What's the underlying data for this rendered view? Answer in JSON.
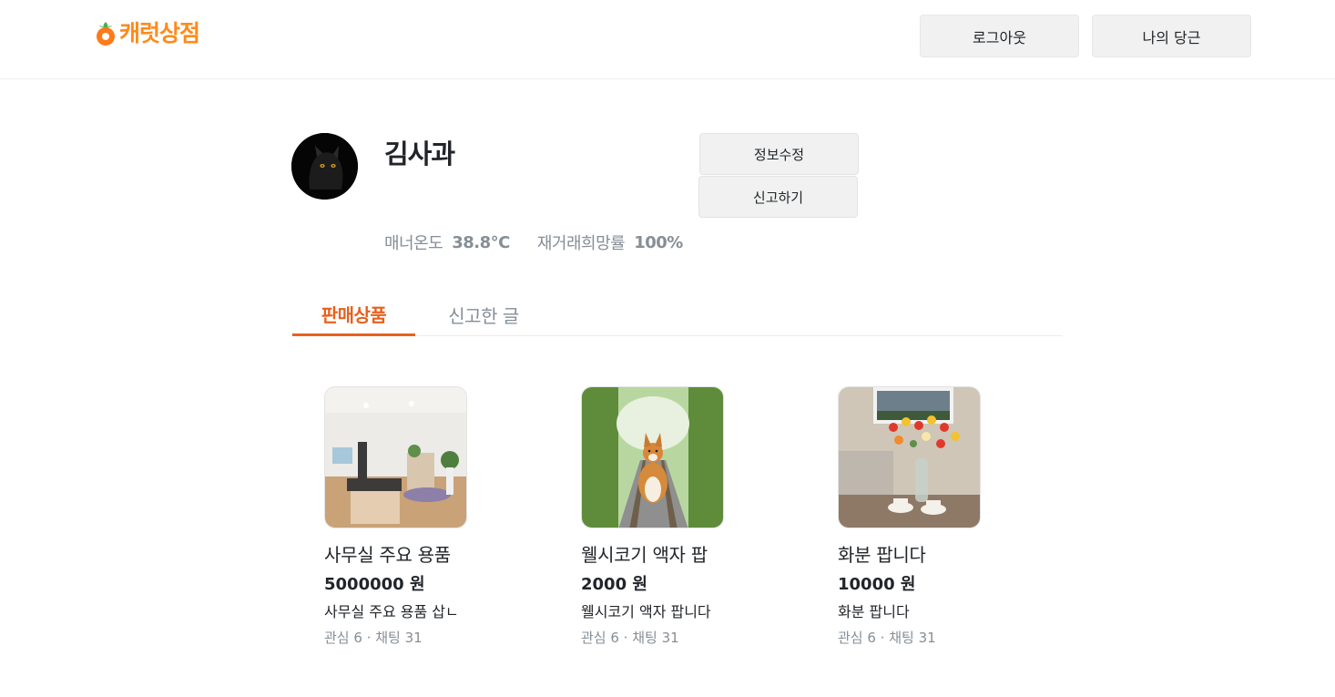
{
  "header": {
    "logo_text": "캐럿상점",
    "logout_label": "로그아웃",
    "my_carrot_label": "나의 당근"
  },
  "profile": {
    "name": "김사과",
    "edit_label": "정보수정",
    "report_label": "신고하기",
    "manner_label": "매너온도",
    "manner_value": "38.8°C",
    "rebuy_label": "재거래희망률",
    "rebuy_value": "100%"
  },
  "tabs": {
    "selling": "판매상품",
    "reported": "신고한 글"
  },
  "products": [
    {
      "title": "사무실 주요 용품",
      "price": "5000000 원",
      "desc": "사무실 주요 용품 삽ㄴ",
      "meta": "관심 6 · 채팅 31"
    },
    {
      "title": "웰시코기 액자 팝",
      "price": "2000 원",
      "desc": "웰시코기 액자 팝니다",
      "meta": "관심 6 · 채팅 31"
    },
    {
      "title": "화분 팝니다",
      "price": "10000 원",
      "desc": "화분 팝니다",
      "meta": "관심 6 · 채팅 31"
    }
  ],
  "colors": {
    "brand_orange": "#ff8a1a",
    "tab_active": "#e8601c",
    "muted": "#868e96",
    "button_bg": "#f1f1f1"
  }
}
